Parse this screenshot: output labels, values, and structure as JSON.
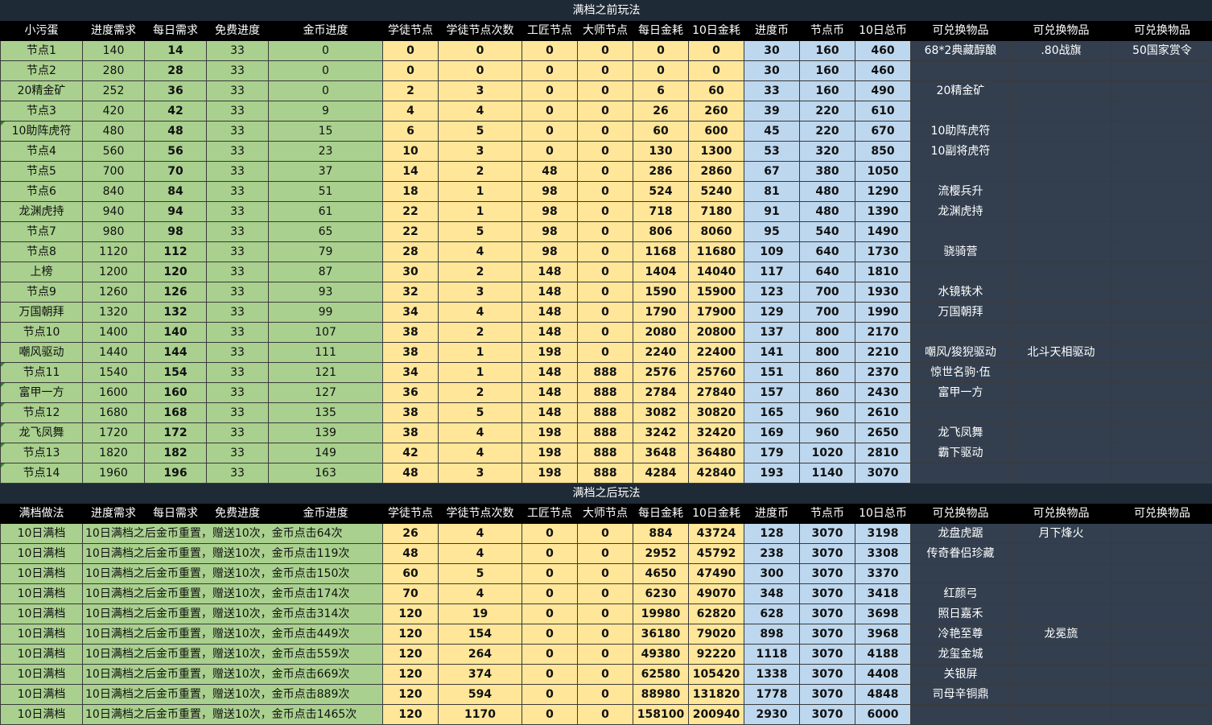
{
  "before": {
    "title": "满档之前玩法",
    "headers": [
      "小污蛋",
      "进度需求",
      "每日需求",
      "免费进度",
      "金币进度",
      "学徒节点",
      "学徒节点次数",
      "工匠节点",
      "大师节点",
      "每日金耗",
      "10日金耗",
      "进度币",
      "节点币",
      "10日总币",
      "可兑换物品",
      "可兑换物品",
      "可兑换物品"
    ],
    "rows": [
      [
        "节点1",
        "140",
        "14",
        "33",
        "0",
        "0",
        "0",
        "0",
        "0",
        "0",
        "0",
        "30",
        "160",
        "460",
        "68*2典藏醇酿",
        ".80战旗",
        "50国家赏令"
      ],
      [
        "节点2",
        "280",
        "28",
        "33",
        "0",
        "0",
        "0",
        "0",
        "0",
        "0",
        "0",
        "30",
        "160",
        "460",
        "",
        "",
        ""
      ],
      [
        "20精金矿",
        "252",
        "36",
        "33",
        "0",
        "2",
        "3",
        "0",
        "0",
        "6",
        "60",
        "33",
        "160",
        "490",
        "20精金矿",
        "",
        ""
      ],
      [
        "节点3",
        "420",
        "42",
        "33",
        "9",
        "4",
        "4",
        "0",
        "0",
        "26",
        "260",
        "39",
        "220",
        "610",
        "",
        "",
        ""
      ],
      [
        "10助阵虎符",
        "480",
        "48",
        "33",
        "15",
        "6",
        "5",
        "0",
        "0",
        "60",
        "600",
        "45",
        "220",
        "670",
        "10助阵虎符",
        "",
        ""
      ],
      [
        "节点4",
        "560",
        "56",
        "33",
        "23",
        "10",
        "3",
        "0",
        "0",
        "130",
        "1300",
        "53",
        "320",
        "850",
        "10副将虎符",
        "",
        ""
      ],
      [
        "节点5",
        "700",
        "70",
        "33",
        "37",
        "14",
        "2",
        "48",
        "0",
        "286",
        "2860",
        "67",
        "380",
        "1050",
        "",
        "",
        ""
      ],
      [
        "节点6",
        "840",
        "84",
        "33",
        "51",
        "18",
        "1",
        "98",
        "0",
        "524",
        "5240",
        "81",
        "480",
        "1290",
        "流樱兵升",
        "",
        ""
      ],
      [
        "龙渊虎持",
        "940",
        "94",
        "33",
        "61",
        "22",
        "1",
        "98",
        "0",
        "718",
        "7180",
        "91",
        "480",
        "1390",
        "龙渊虎持",
        "",
        ""
      ],
      [
        "节点7",
        "980",
        "98",
        "33",
        "65",
        "22",
        "5",
        "98",
        "0",
        "806",
        "8060",
        "95",
        "540",
        "1490",
        "",
        "",
        ""
      ],
      [
        "节点8",
        "1120",
        "112",
        "33",
        "79",
        "28",
        "4",
        "98",
        "0",
        "1168",
        "11680",
        "109",
        "640",
        "1730",
        "骁骑营",
        "",
        ""
      ],
      [
        "上榜",
        "1200",
        "120",
        "33",
        "87",
        "30",
        "2",
        "148",
        "0",
        "1404",
        "14040",
        "117",
        "640",
        "1810",
        "",
        "",
        ""
      ],
      [
        "节点9",
        "1260",
        "126",
        "33",
        "93",
        "32",
        "3",
        "148",
        "0",
        "1590",
        "15900",
        "123",
        "700",
        "1930",
        "水镜轶术",
        "",
        ""
      ],
      [
        "万国朝拜",
        "1320",
        "132",
        "33",
        "99",
        "34",
        "4",
        "148",
        "0",
        "1790",
        "17900",
        "129",
        "700",
        "1990",
        "万国朝拜",
        "",
        ""
      ],
      [
        "节点10",
        "1400",
        "140",
        "33",
        "107",
        "38",
        "2",
        "148",
        "0",
        "2080",
        "20800",
        "137",
        "800",
        "2170",
        "",
        "",
        ""
      ],
      [
        "嘲风驱动",
        "1440",
        "144",
        "33",
        "111",
        "38",
        "1",
        "198",
        "0",
        "2240",
        "22400",
        "141",
        "800",
        "2210",
        "嘲风/狻猊驱动",
        "北斗天相驱动",
        ""
      ],
      [
        "节点11",
        "1540",
        "154",
        "33",
        "121",
        "34",
        "1",
        "148",
        "888",
        "2576",
        "25760",
        "151",
        "860",
        "2370",
        "惊世名驹·伍",
        "",
        ""
      ],
      [
        "富甲一方",
        "1600",
        "160",
        "33",
        "127",
        "36",
        "2",
        "148",
        "888",
        "2784",
        "27840",
        "157",
        "860",
        "2430",
        "富甲一方",
        "",
        ""
      ],
      [
        "节点12",
        "1680",
        "168",
        "33",
        "135",
        "38",
        "5",
        "148",
        "888",
        "3082",
        "30820",
        "165",
        "960",
        "2610",
        "",
        "",
        ""
      ],
      [
        "龙飞凤舞",
        "1720",
        "172",
        "33",
        "139",
        "38",
        "4",
        "198",
        "888",
        "3242",
        "32420",
        "169",
        "960",
        "2650",
        "龙飞凤舞",
        "",
        ""
      ],
      [
        "节点13",
        "1820",
        "182",
        "33",
        "149",
        "42",
        "4",
        "198",
        "888",
        "3648",
        "36480",
        "179",
        "1020",
        "2810",
        "霸下驱动",
        "",
        ""
      ],
      [
        "节点14",
        "1960",
        "196",
        "33",
        "163",
        "48",
        "3",
        "198",
        "888",
        "4284",
        "42840",
        "193",
        "1140",
        "3070",
        "",
        "",
        ""
      ]
    ]
  },
  "after": {
    "title": "满档之后玩法",
    "headers": [
      "满档做法",
      "进度需求",
      "每日需求",
      "免费进度",
      "金币进度",
      "学徒节点",
      "学徒节点次数",
      "工匠节点",
      "大师节点",
      "每日金耗",
      "10日金耗",
      "进度币",
      "节点币",
      "10日总币",
      "可兑换物品",
      "可兑换物品",
      "可兑换物品"
    ],
    "rows": [
      [
        "10日满档",
        "10日满档之后金币重置，赠送10次，金币点击64次",
        "26",
        "4",
        "0",
        "0",
        "884",
        "43724",
        "128",
        "3070",
        "3198",
        "龙盘虎踞",
        "月下烽火",
        ""
      ],
      [
        "10日满档",
        "10日满档之后金币重置，赠送10次，金币点击119次",
        "48",
        "4",
        "0",
        "0",
        "2952",
        "45792",
        "238",
        "3070",
        "3308",
        "传奇眷侣珍藏",
        "",
        ""
      ],
      [
        "10日满档",
        "10日满档之后金币重置，赠送10次，金币点击150次",
        "60",
        "5",
        "0",
        "0",
        "4650",
        "47490",
        "300",
        "3070",
        "3370",
        "",
        "",
        ""
      ],
      [
        "10日满档",
        "10日满档之后金币重置，赠送10次，金币点击174次",
        "70",
        "4",
        "0",
        "0",
        "6230",
        "49070",
        "348",
        "3070",
        "3418",
        "红颜弓",
        "",
        ""
      ],
      [
        "10日满档",
        "10日满档之后金币重置，赠送10次，金币点击314次",
        "120",
        "19",
        "0",
        "0",
        "19980",
        "62820",
        "628",
        "3070",
        "3698",
        "照日嘉禾",
        "",
        ""
      ],
      [
        "10日满档",
        "10日满档之后金币重置，赠送10次，金币点击449次",
        "120",
        "154",
        "0",
        "0",
        "36180",
        "79020",
        "898",
        "3070",
        "3968",
        "冷艳至尊",
        "龙冕旒",
        ""
      ],
      [
        "10日满档",
        "10日满档之后金币重置，赠送10次，金币点击559次",
        "120",
        "264",
        "0",
        "0",
        "49380",
        "92220",
        "1118",
        "3070",
        "4188",
        "龙玺金城",
        "",
        ""
      ],
      [
        "10日满档",
        "10日满档之后金币重置，赠送10次，金币点击669次",
        "120",
        "374",
        "0",
        "0",
        "62580",
        "105420",
        "1338",
        "3070",
        "4408",
        "关银屏",
        "",
        ""
      ],
      [
        "10日满档",
        "10日满档之后金币重置，赠送10次，金币点击889次",
        "120",
        "594",
        "0",
        "0",
        "88980",
        "131820",
        "1778",
        "3070",
        "4848",
        "司母辛铜鼎",
        "",
        ""
      ],
      [
        "10日满档",
        "10日满档之后金币重置，赠送10次，金币点击1465次",
        "120",
        "1170",
        "0",
        "0",
        "158100",
        "200940",
        "2930",
        "3070",
        "6000",
        "",
        "",
        ""
      ]
    ]
  },
  "colors": {
    "green": "#a9d08e",
    "yellow": "#ffe699",
    "blue": "#bdd7ee",
    "dark": "#333f4f",
    "header": "#000000"
  }
}
